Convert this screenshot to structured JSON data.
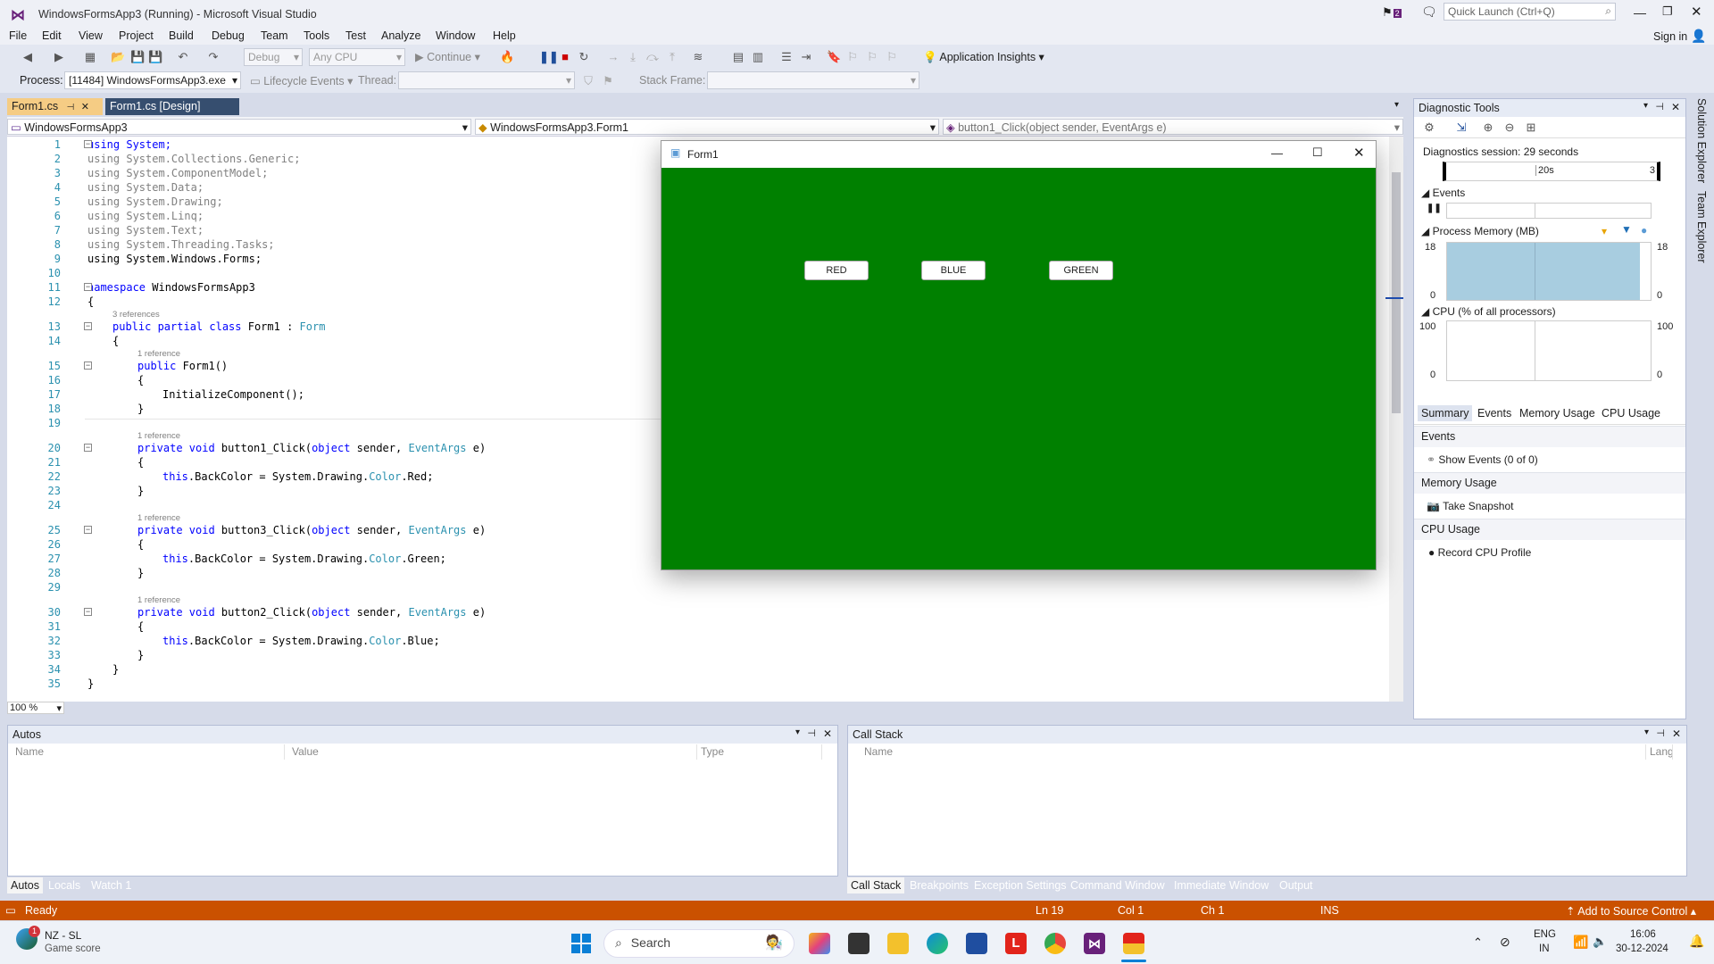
{
  "window": {
    "title": "WindowsFormsApp3 (Running) - Microsoft Visual Studio",
    "notif_count": "2",
    "quick_launch_placeholder": "Quick Launch (Ctrl+Q)",
    "sign_in": "Sign in"
  },
  "menu": [
    "File",
    "Edit",
    "View",
    "Project",
    "Build",
    "Debug",
    "Team",
    "Tools",
    "Test",
    "Analyze",
    "Window",
    "Help"
  ],
  "toolbar": {
    "config": "Debug",
    "platform": "Any CPU",
    "continue": "Continue",
    "app_insights": "Application Insights"
  },
  "debugbar": {
    "process_label": "Process:",
    "process_value": "[11484] WindowsFormsApp3.exe",
    "lifecycle": "Lifecycle Events",
    "thread_label": "Thread:",
    "stackframe_label": "Stack Frame:"
  },
  "doc_tabs": [
    "Form1.cs",
    "Form1.cs [Design]"
  ],
  "nav": {
    "project": "WindowsFormsApp3",
    "class": "WindowsFormsApp3.Form1",
    "member": "button1_Click(object sender, EventArgs e)"
  },
  "editor": {
    "zoom": "100 %"
  },
  "code_lines": [
    "1",
    "2",
    "3",
    "4",
    "5",
    "6",
    "7",
    "8",
    "9",
    "10",
    "11",
    "12",
    "13",
    "14",
    "15",
    "16",
    "17",
    "18",
    "19",
    "20",
    "21",
    "22",
    "23",
    "24",
    "25",
    "26",
    "27",
    "28",
    "29",
    "30",
    "31",
    "32",
    "33",
    "34",
    "35"
  ],
  "code": {
    "l1": "using System;",
    "l2": "using System.Collections.Generic;",
    "l3": "using System.ComponentModel;",
    "l4": "using System.Data;",
    "l5": "using System.Drawing;",
    "l6": "using System.Linq;",
    "l7": "using System.Text;",
    "l8": "using System.Threading.Tasks;",
    "l9": "using System.Windows.Forms;",
    "l11_kw": "namespace",
    "l11_rest": " WindowsFormsApp3",
    "brace_open": "{",
    "brace_close": "}",
    "ref3": "3 references",
    "ref1": "1 reference",
    "l13_kw": "public partial class",
    "l13_name": " Form1 : ",
    "l13_base": "Form",
    "l15_kw": "public",
    "l15_rest": " Form1()",
    "l17": "InitializeComponent();",
    "private_void": "private void",
    "object_kw": "object",
    "sender": " sender, ",
    "eventargs": "EventArgs",
    "e_close": " e)",
    "l20_name": " button1_Click(",
    "l25_name": " button3_Click(",
    "l30_name": " button2_Click(",
    "this_kw": "this",
    "backcolor": ".BackColor = System.Drawing.",
    "color_ty": "Color",
    "red": ".Red;",
    "green": ".Green;",
    "blue": ".Blue;"
  },
  "form1": {
    "title": "Form1",
    "back_color": "#008000",
    "buttons": [
      "RED",
      "BLUE",
      "GREEN"
    ]
  },
  "diagnostics": {
    "title": "Diagnostic Tools",
    "session": "Diagnostics session: 29 seconds",
    "timeline_tick": "20s",
    "timeline_end": "3",
    "events_label": "Events",
    "memory_label": "Process Memory (MB)",
    "memory_max": "18",
    "memory_min": "0",
    "cpu_label": "CPU (% of all processors)",
    "cpu_max": "100",
    "cpu_min": "0",
    "tabs": [
      "Summary",
      "Events",
      "Memory Usage",
      "CPU Usage"
    ],
    "sec_events": "Events",
    "show_events": "Show Events (0 of 0)",
    "sec_memory": "Memory Usage",
    "take_snapshot": "Take Snapshot",
    "sec_cpu": "CPU Usage",
    "record_cpu": "Record CPU Profile"
  },
  "right_rail": [
    "Solution Explorer",
    "Team Explorer"
  ],
  "autos": {
    "title": "Autos",
    "columns": [
      "Name",
      "Value",
      "Type"
    ],
    "tabs": [
      "Autos",
      "Locals",
      "Watch 1"
    ]
  },
  "callstack": {
    "title": "Call Stack",
    "columns": [
      "Name",
      "Lang"
    ],
    "tabs": [
      "Call Stack",
      "Breakpoints",
      "Exception Settings",
      "Command Window",
      "Immediate Window",
      "Output"
    ]
  },
  "status": {
    "ready": "Ready",
    "ln": "Ln 19",
    "col": "Col 1",
    "ch": "Ch 1",
    "mode": "INS",
    "source_control": "Add to Source Control"
  },
  "taskbar": {
    "weather_title": "NZ - SL",
    "weather_sub": "Game score",
    "weather_badge": "1",
    "search": "Search",
    "lang1": "ENG",
    "lang2": "IN",
    "time": "16:06",
    "date": "30-12-2024"
  }
}
